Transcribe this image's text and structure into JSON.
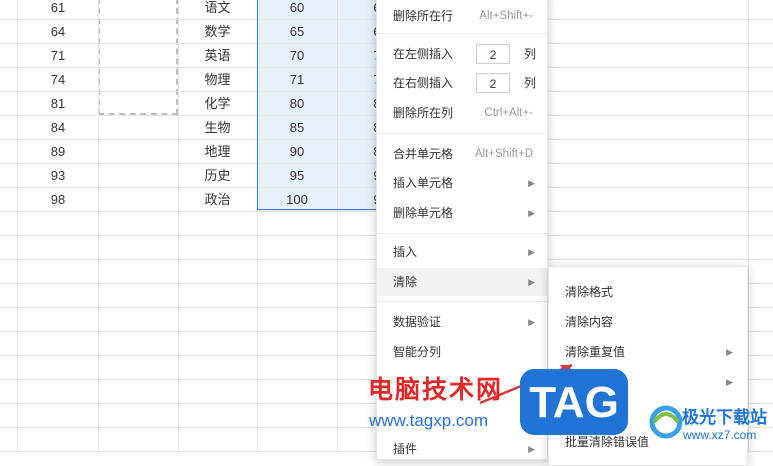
{
  "rows": [
    {
      "id": "61",
      "subject": "语文",
      "score": "60",
      "next": "6"
    },
    {
      "id": "64",
      "subject": "数学",
      "score": "65",
      "next": "6"
    },
    {
      "id": "71",
      "subject": "英语",
      "score": "70",
      "next": "7"
    },
    {
      "id": "74",
      "subject": "物理",
      "score": "71",
      "next": "7"
    },
    {
      "id": "81",
      "subject": "化学",
      "score": "80",
      "next": "8"
    },
    {
      "id": "84",
      "subject": "生物",
      "score": "85",
      "next": "8"
    },
    {
      "id": "89",
      "subject": "地理",
      "score": "90",
      "next": "8"
    },
    {
      "id": "93",
      "subject": "历史",
      "score": "95",
      "next": "9"
    },
    {
      "id": "98",
      "subject": "政治",
      "score": "100",
      "next": "9"
    }
  ],
  "context_menu": {
    "delete_row": {
      "label": "删除所在行",
      "shortcut": "Alt+Shift+-"
    },
    "insert_left": {
      "label": "在左侧插入",
      "count": "2",
      "unit": "列"
    },
    "insert_right": {
      "label": "在右侧插入",
      "count": "2",
      "unit": "列"
    },
    "delete_col": {
      "label": "删除所在列",
      "shortcut": "Ctrl+Alt+-"
    },
    "merge": {
      "label": "合并单元格",
      "shortcut": "Alt+Shift+D"
    },
    "insert_cells": {
      "label": "插入单元格"
    },
    "delete_cells": {
      "label": "删除单元格"
    },
    "insert": {
      "label": "插入"
    },
    "clear": {
      "label": "清除"
    },
    "data_validation": {
      "label": "数据验证"
    },
    "smart_split": {
      "label": "智能分列"
    },
    "plugin": {
      "label": "插件"
    }
  },
  "clear_submenu": {
    "clear_format": "清除格式",
    "clear_content": "清除内容",
    "clear_duplicates": "清除重复值",
    "batch_clear_errors": "批量清除错误值"
  },
  "watermark": {
    "site_name": "电脑技术网",
    "site_url": "www.tagxp.com",
    "logo_text": "TAG",
    "brand_name": "极光下载站",
    "brand_url": "www.xz7.com"
  },
  "colors": {
    "selection_fill": "#e6f1fc",
    "selection_border": "#3a7bd5",
    "watermark_red": "#e02a2a",
    "tag_blue": "#1f74d6"
  }
}
